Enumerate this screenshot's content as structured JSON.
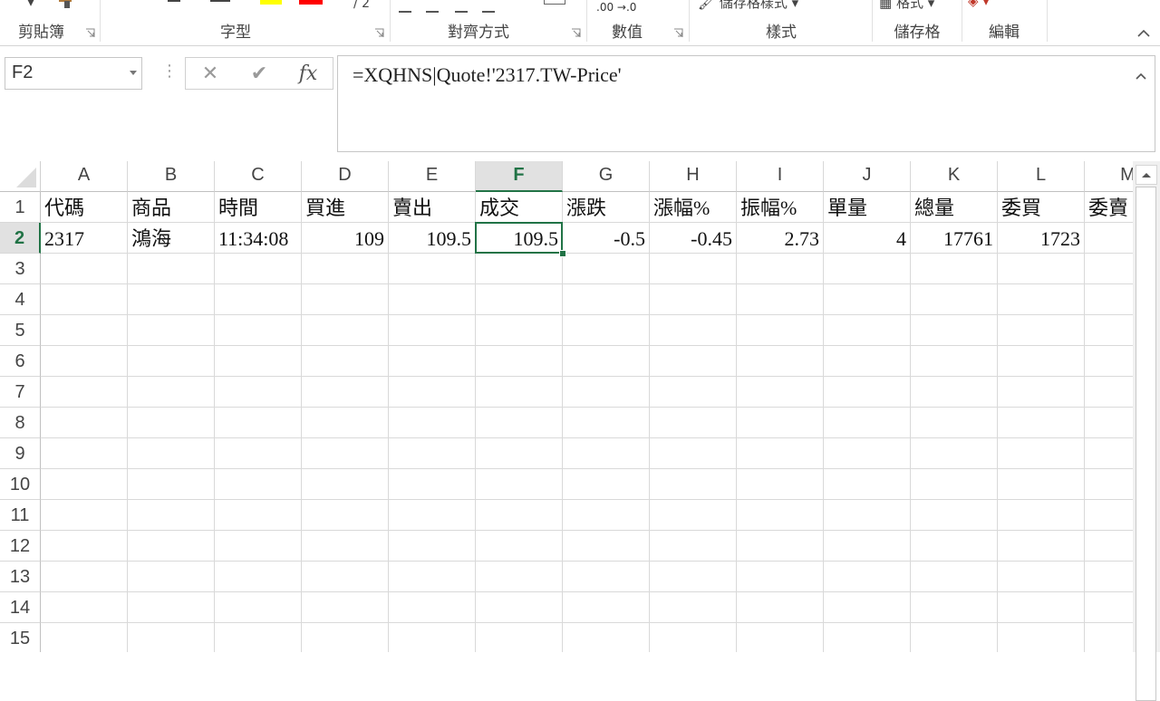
{
  "ribbon": {
    "groups": [
      {
        "label": "剪貼簿",
        "launcher": true
      },
      {
        "label": "字型",
        "launcher": true
      },
      {
        "label": "對齊方式",
        "launcher": true
      },
      {
        "label": "數值",
        "launcher": true
      },
      {
        "label": "樣式",
        "launcher": false
      },
      {
        "label": "儲存格",
        "launcher": false
      },
      {
        "label": "編輯",
        "launcher": false
      }
    ],
    "fragments": {
      "number_format": ".00 →.0",
      "cell_styles": "儲存格樣式 ▾",
      "format": "格式 ▾"
    },
    "colors": {
      "highlight": "#ffff00",
      "font_color": "#ff0000"
    }
  },
  "formula_bar": {
    "name_box": "F2",
    "cancel_icon": "✕",
    "enter_icon": "✔",
    "fx_label": "fx",
    "formula": "=XQHNS|Quote!'2317.TW-Price'"
  },
  "sheet": {
    "columns": [
      "A",
      "B",
      "C",
      "D",
      "E",
      "F",
      "G",
      "H",
      "I",
      "J",
      "K",
      "L",
      "M"
    ],
    "selected_column": "F",
    "selected_row": 2,
    "rows": [
      "1",
      "2",
      "3",
      "4",
      "5",
      "6",
      "7",
      "8",
      "9",
      "10",
      "11",
      "12",
      "13",
      "14",
      "15"
    ],
    "cells": {
      "r1": [
        "代碼",
        "商品",
        "時間",
        "買進",
        "賣出",
        "成交",
        "漲跌",
        "漲幅%",
        "振幅%",
        "單量",
        "總量",
        "委買",
        "委賣"
      ],
      "r2": [
        "2317",
        "鴻海",
        "11:34:08",
        "109",
        "109.5",
        "109.5",
        "-0.5",
        "-0.45",
        "2.73",
        "4",
        "17761",
        "1723",
        ""
      ]
    },
    "accent_color": "#217346"
  }
}
